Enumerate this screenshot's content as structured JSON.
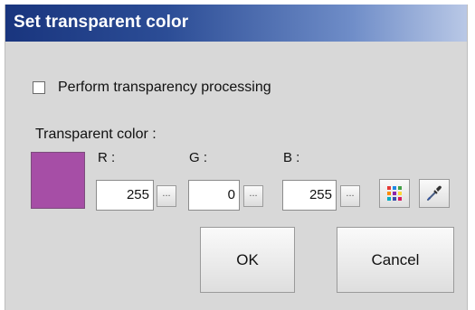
{
  "window": {
    "title": "Set transparent color"
  },
  "transparency": {
    "checkbox_label": "Perform transparency processing",
    "checked": false
  },
  "color": {
    "section_label": "Transparent color :",
    "swatch_color": "#a64ea6",
    "r": {
      "label": "R :",
      "value": "255",
      "more": "..."
    },
    "g": {
      "label": "G :",
      "value": "0",
      "more": "..."
    },
    "b": {
      "label": "B :",
      "value": "255",
      "more": "..."
    }
  },
  "tools": {
    "palette_icon": "color-palette-icon",
    "picker_icon": "eyedropper-icon"
  },
  "buttons": {
    "ok": "OK",
    "cancel": "Cancel"
  },
  "colors": {
    "title_start": "#19357e",
    "title_end": "#b9c8e6",
    "dialog_bg": "#d8d8d8"
  }
}
